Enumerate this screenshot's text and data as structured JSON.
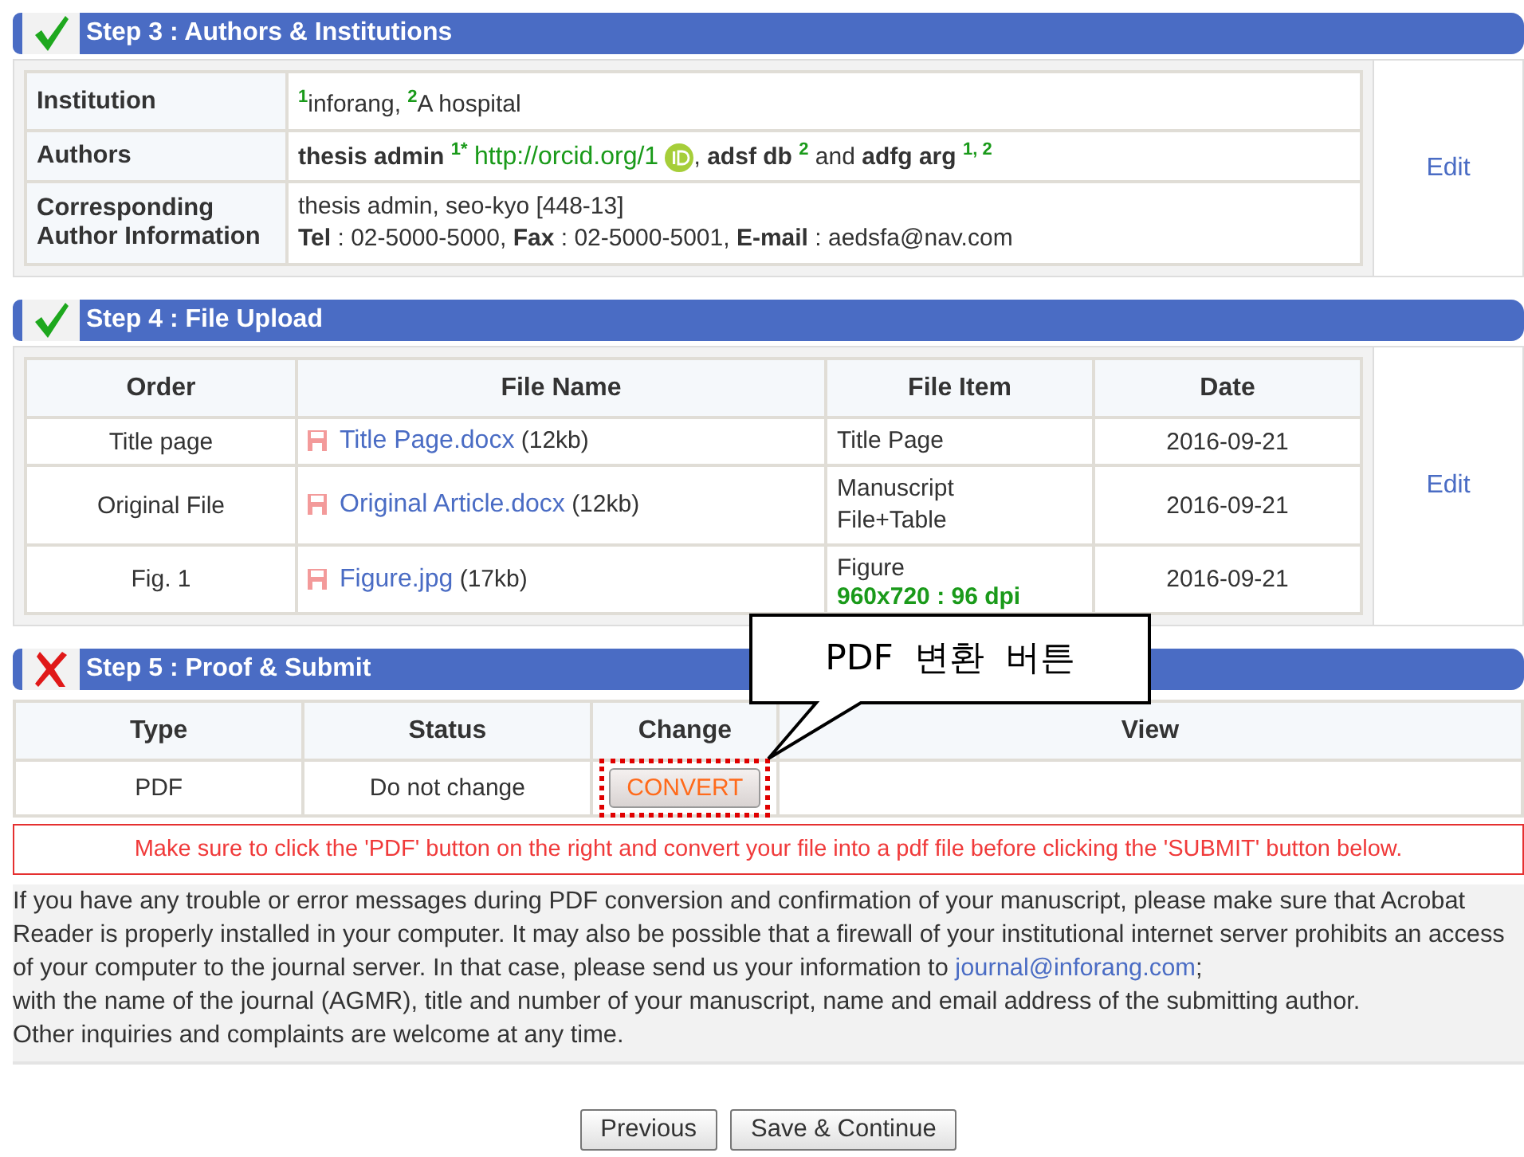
{
  "steps": [
    {
      "complete": true,
      "title": "Step 3 : Authors & Institutions",
      "kind": "info",
      "edit": "Edit",
      "rows": [
        {
          "label": "Institution",
          "kind": "text",
          "lines": [
            "$^{1}$inforang, $^{2}$A hospital"
          ]
        },
        {
          "label": "Authors",
          "kind": "authors",
          "authors": [
            {
              "name": "thesis admin",
              "sup": "1*",
              "orcid": "http://orcid.org/1",
              "joiner": ", "
            },
            {
              "name": "adsf db",
              "sup": "2",
              "joiner": " and "
            },
            {
              "name": "adfg arg",
              "sup": "1, 2"
            }
          ]
        },
        {
          "label": "Corresponding Author Information",
          "kind": "text",
          "lines": [
            "thesis admin, seo-kyo [448-13]",
            "**Tel** : 02-5000-5000, **Fax** : 02-5000-5001, **E-mail** : aedsfa@nav.com"
          ]
        }
      ]
    },
    {
      "complete": true,
      "title": "Step 4 : File Upload",
      "kind": "files",
      "edit": "Edit",
      "columns": [
        "Order",
        "File Name",
        "File Item",
        "Date"
      ],
      "rows": [
        {
          "order": "Title page",
          "file": "Title Page.docx",
          "size": "(12kb)",
          "item": [
            "Title Page"
          ],
          "date": "2016-09-21"
        },
        {
          "order": "Original File",
          "file": "Original Article.docx",
          "size": "(12kb)",
          "item": [
            "Manuscript",
            "File+Table"
          ],
          "date": "2016-09-21"
        },
        {
          "order": "Fig. 1",
          "file": "Figure.jpg",
          "size": "(17kb)",
          "item": [
            "Figure"
          ],
          "note": "960x720 : 96 dpi",
          "date": "2016-09-21"
        }
      ]
    },
    {
      "complete": false,
      "title": "Step 5 : Proof & Submit",
      "kind": "proof",
      "columns": [
        "Type",
        "Status",
        "Change",
        "View"
      ],
      "rows": [
        {
          "type": "PDF",
          "status": "Do not change",
          "button": "CONVERT"
        }
      ],
      "warning": "Make sure to click the 'PDF' button on the right and convert your file into a pdf file before clicking the 'SUBMIT' button below.",
      "help": {
        "before": "If you have any trouble or error messages during PDF conversion and confirmation of your manuscript, please make sure that Acrobat Reader is properly installed in your computer. It may also be possible that a firewall of your institutional internet server prohibits an access of your computer to the journal server. In that case, please send us your information to ",
        "link": "journal@inforang.com",
        "after": ";",
        "lines": [
          "with the name of the journal (AGMR), title and number of your manuscript, name and email address of the submitting author.",
          "Other inquiries and complaints are welcome at any time."
        ]
      }
    }
  ],
  "buttons": [
    "Previous",
    "Save & Continue"
  ],
  "callout": "PDF 변환 버튼"
}
